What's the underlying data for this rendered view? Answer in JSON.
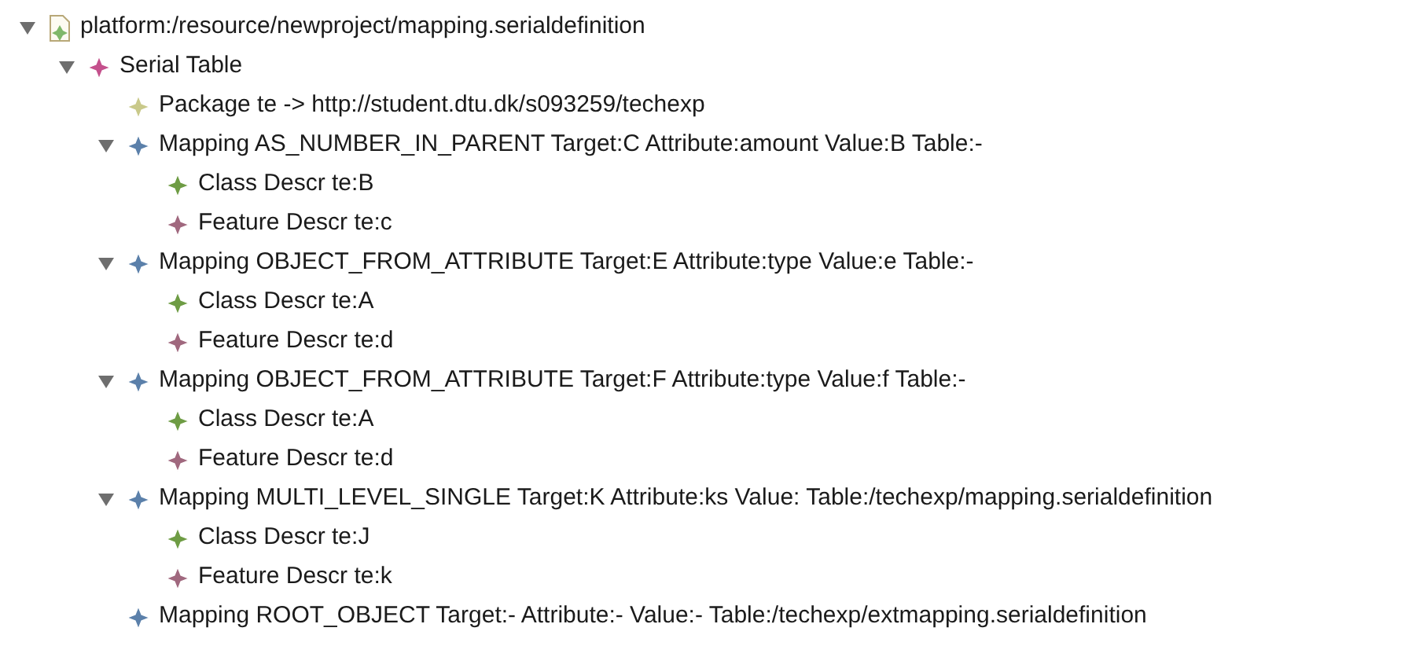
{
  "tree": [
    {
      "kind": "file",
      "label": "platform:/resource/newproject/mapping.serialdefinition",
      "expanded": true,
      "children": [
        {
          "kind": "table",
          "label": "Serial Table",
          "expanded": true,
          "children": [
            {
              "kind": "package",
              "label": "Package te -> http://student.dtu.dk/s093259/techexp"
            },
            {
              "kind": "mapping",
              "label": "Mapping AS_NUMBER_IN_PARENT Target:C Attribute:amount Value:B Table:-",
              "expanded": true,
              "children": [
                {
                  "kind": "class",
                  "label": "Class Descr te:B"
                },
                {
                  "kind": "feature",
                  "label": "Feature Descr te:c"
                }
              ]
            },
            {
              "kind": "mapping",
              "label": "Mapping OBJECT_FROM_ATTRIBUTE Target:E Attribute:type Value:e Table:-",
              "expanded": true,
              "children": [
                {
                  "kind": "class",
                  "label": "Class Descr te:A"
                },
                {
                  "kind": "feature",
                  "label": "Feature Descr te:d"
                }
              ]
            },
            {
              "kind": "mapping",
              "label": "Mapping OBJECT_FROM_ATTRIBUTE Target:F Attribute:type Value:f Table:-",
              "expanded": true,
              "children": [
                {
                  "kind": "class",
                  "label": "Class Descr te:A"
                },
                {
                  "kind": "feature",
                  "label": "Feature Descr te:d"
                }
              ]
            },
            {
              "kind": "mapping",
              "label": "Mapping MULTI_LEVEL_SINGLE Target:K Attribute:ks Value: Table:/techexp/mapping.serialdefinition",
              "expanded": true,
              "children": [
                {
                  "kind": "class",
                  "label": "Class Descr te:J"
                },
                {
                  "kind": "feature",
                  "label": "Feature Descr te:k"
                }
              ]
            },
            {
              "kind": "mapping",
              "label": "Mapping ROOT_OBJECT Target:- Attribute:- Value:- Table:/techexp/extmapping.serialdefinition"
            }
          ]
        }
      ]
    }
  ]
}
